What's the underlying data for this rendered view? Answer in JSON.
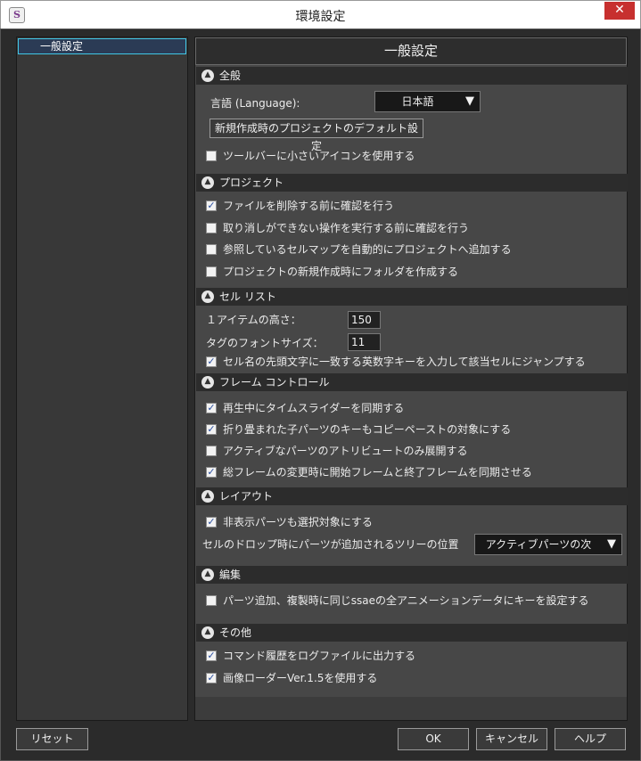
{
  "window": {
    "title": "環境設定",
    "app_icon": "S",
    "close": "✕"
  },
  "tree": {
    "items": [
      "一般設定"
    ]
  },
  "panel": {
    "title": "一般設定",
    "sections": {
      "general": {
        "title": "全般",
        "language_label": "言語 (Language):",
        "language_value": "日本語",
        "project_defaults_button": "新規作成時のプロジェクトのデフォルト設定",
        "small_icons": "ツールバーに小さいアイコンを使用する"
      },
      "project": {
        "title": "プロジェクト",
        "items": [
          "ファイルを削除する前に確認を行う",
          "取り消しができない操作を実行する前に確認を行う",
          "参照しているセルマップを自動的にプロジェクトへ追加する",
          "プロジェクトの新規作成時にフォルダを作成する"
        ],
        "checked": [
          true,
          false,
          false,
          false
        ]
      },
      "cell_list": {
        "title": "セル リスト",
        "item_height_label": "１アイテムの高さ：",
        "item_height_value": "150",
        "tag_font_label": "タグのフォントサイズ：",
        "tag_font_value": "11",
        "jump_option": "セル名の先頭文字に一致する英数字キーを入力して該当セルにジャンプする"
      },
      "frame_control": {
        "title": "フレーム コントロール",
        "items": [
          "再生中にタイムスライダーを同期する",
          "折り畳まれた子パーツのキーもコピーペーストの対象にする",
          "アクティブなパーツのアトリビュートのみ展開する",
          "総フレームの変更時に開始フレームと終了フレームを同期させる"
        ],
        "checked": [
          true,
          true,
          false,
          true
        ]
      },
      "layout": {
        "title": "レイアウト",
        "hidden_parts_selectable": "非表示パーツも選択対象にする",
        "drop_position_label": "セルのドロップ時にパーツが追加されるツリーの位置",
        "drop_position_value": "アクティブパーツの次"
      },
      "edit": {
        "title": "編集",
        "set_key_option": "パーツ追加、複製時に同じssaeの全アニメーションデータにキーを設定する"
      },
      "other": {
        "title": "その他",
        "items": [
          "コマンド履歴をログファイルに出力する",
          "画像ローダーVer.1.5を使用する"
        ],
        "checked": [
          true,
          true
        ]
      }
    }
  },
  "footer": {
    "reset": "リセット",
    "ok": "OK",
    "cancel": "キャンセル",
    "help": "ヘルプ"
  },
  "symbols": {
    "check": "✓",
    "collapse": "▲",
    "dropdown_arrow": "▼"
  },
  "colors": {
    "accent": "#41c7e6",
    "close_red": "#c7302f",
    "check_blue": "#2a4ea0"
  }
}
